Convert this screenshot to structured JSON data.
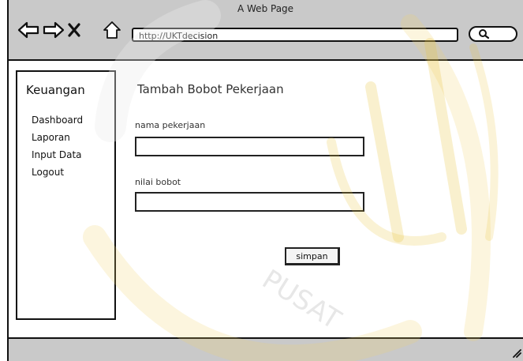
{
  "window": {
    "title": "A Web Page"
  },
  "toolbar": {
    "back_icon": "back-arrow-icon",
    "forward_icon": "forward-arrow-icon",
    "stop_icon": "close-icon",
    "home_icon": "home-icon",
    "url": "http://UKTdecision",
    "search_icon": "search-icon"
  },
  "sidebar": {
    "title": "Keuangan",
    "items": [
      {
        "label": "Dashboard"
      },
      {
        "label": "Laporan"
      },
      {
        "label": "Input Data"
      },
      {
        "label": "Logout"
      }
    ]
  },
  "main": {
    "title": "Tambah Bobot Pekerjaan",
    "fields": [
      {
        "label": "nama pekerjaan",
        "value": ""
      },
      {
        "label": "nilai bobot",
        "value": ""
      }
    ],
    "save_label": "simpan"
  },
  "watermark": {
    "text": "PUSAT"
  },
  "colors": {
    "chrome": "#c9c9c9",
    "watermark": "#e9c23a",
    "border": "#111111"
  }
}
